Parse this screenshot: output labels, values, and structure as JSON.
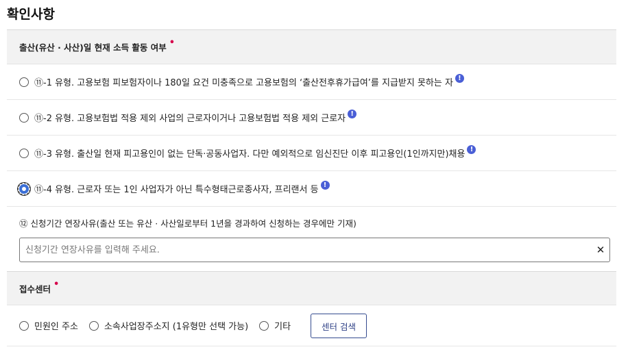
{
  "page_title": "확인사항",
  "section1": {
    "title": "출산(유산 · 사산)일 현재 소득 활동 여부",
    "required_mark": "•",
    "options": [
      {
        "label": "⑪-1 유형. 고용보험 피보험자이나 180일 요건 미충족으로 고용보험의 ‘출산전후휴가급여’를 지급받지 못하는 자",
        "info": "!",
        "checked": false
      },
      {
        "label": "⑪-2 유형. 고용보험법 적용 제외 사업의 근로자이거나 고용보험법 적용 제외 근로자",
        "info": "!",
        "checked": false
      },
      {
        "label": "⑪-3 유형. 출산일 현재 피고용인이 없는 단독·공동사업자. 다만 예외적으로 임신진단 이후 피고용인(1인까지만)채용",
        "info": "!",
        "checked": false
      },
      {
        "label": "⑪-4 유형. 근로자 또는 1인 사업자가 아닌 특수형태근로종사자, 프리랜서 등",
        "info": "!",
        "checked": true
      }
    ]
  },
  "extension": {
    "label": "⑫ 신청기간 연장사유(출산 또는 유산 · 사산일로부터 1년을 경과하여 신청하는 경우에만 기재)",
    "placeholder": "신청기간 연장사유를 입력해 주세요.",
    "value": "",
    "clear_label": "✕"
  },
  "section2": {
    "title": "접수센터",
    "required_mark": "•",
    "options": [
      {
        "label": "민원인 주소",
        "checked": false
      },
      {
        "label": "소속사업장주소지 (1유형만 선택 가능)",
        "checked": false
      },
      {
        "label": "기타",
        "checked": false
      }
    ],
    "search_button": "센터 검색"
  },
  "colors": {
    "accent": "#3b6fd6",
    "required": "#d6004b",
    "info": "#4a5fd6",
    "button_border": "#334a8e"
  }
}
